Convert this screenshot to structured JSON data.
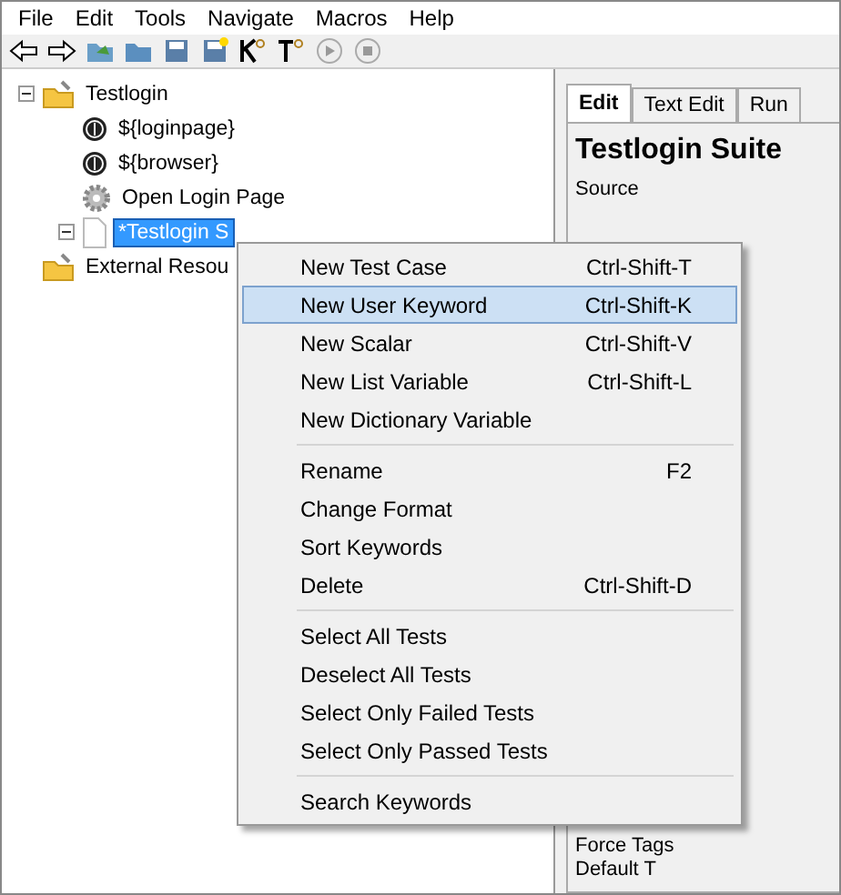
{
  "menu_bar": [
    "File",
    "Edit",
    "Tools",
    "Navigate",
    "Macros",
    "Help"
  ],
  "tree": [
    {
      "label": "Testlogin",
      "kind": "suite",
      "expanded": true,
      "selected": false,
      "children": [
        {
          "label": "${loginpage}",
          "kind": "variable",
          "selected": false
        },
        {
          "label": "${browser}",
          "kind": "variable",
          "selected": false
        },
        {
          "label": "Open Login Page",
          "kind": "keyword",
          "selected": false
        },
        {
          "label": "*Testlogin S",
          "kind": "file",
          "expanded": true,
          "selected": true
        }
      ]
    },
    {
      "label": "External Resou",
      "kind": "suite",
      "selected": false
    }
  ],
  "tabs": [
    {
      "label": "Edit",
      "selected": true
    },
    {
      "label": "Text Edit",
      "selected": false
    },
    {
      "label": "Run",
      "selected": false
    }
  ],
  "editor": {
    "title": "Testlogin Suite",
    "fields": [
      "Source",
      "Force Tags",
      "Default T"
    ]
  },
  "context_menu": [
    [
      {
        "label": "New Test Case",
        "shortcut": "Ctrl-Shift-T",
        "selected": false
      },
      {
        "label": "New User Keyword",
        "shortcut": "Ctrl-Shift-K",
        "selected": true
      },
      {
        "label": "New Scalar",
        "shortcut": "Ctrl-Shift-V",
        "selected": false
      },
      {
        "label": "New List Variable",
        "shortcut": "Ctrl-Shift-L",
        "selected": false
      },
      {
        "label": "New Dictionary Variable",
        "selected": false
      }
    ],
    [
      {
        "label": "Rename",
        "shortcut": "F2",
        "selected": false
      },
      {
        "label": "Change Format",
        "selected": false
      },
      {
        "label": "Sort Keywords",
        "selected": false
      },
      {
        "label": "Delete",
        "shortcut": "Ctrl-Shift-D",
        "selected": false
      }
    ],
    [
      {
        "label": "Select All Tests",
        "selected": false
      },
      {
        "label": "Deselect All Tests",
        "selected": false
      },
      {
        "label": "Select Only Failed Tests",
        "selected": false
      },
      {
        "label": "Select Only Passed Tests",
        "selected": false
      }
    ],
    [
      {
        "label": "Search Keywords",
        "selected": false
      }
    ]
  ]
}
